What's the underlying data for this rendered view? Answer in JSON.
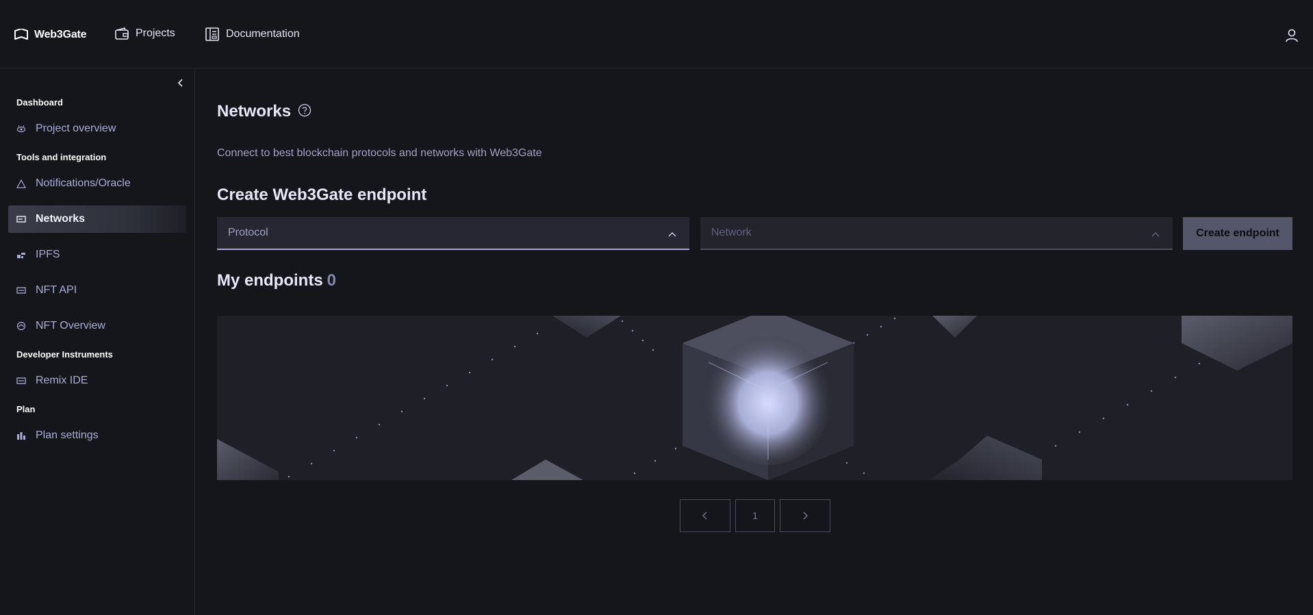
{
  "header": {
    "brand": "Web3Gate",
    "nav": [
      {
        "label": "Projects",
        "icon": "wallet-icon"
      },
      {
        "label": "Documentation",
        "icon": "document-icon"
      }
    ],
    "profile_icon": "user-icon"
  },
  "sidebar": {
    "sections": [
      {
        "title": "Dashboard",
        "items": [
          {
            "label": "Project overview",
            "icon": "eye-icon"
          }
        ]
      },
      {
        "title": "Tools and integration",
        "items": [
          {
            "label": "Notifications/Oracle",
            "icon": "triangle-icon"
          },
          {
            "label": "Networks",
            "icon": "server-icon",
            "active": true
          },
          {
            "label": "IPFS",
            "icon": "blocks-icon"
          },
          {
            "label": "NFT API",
            "icon": "card-icon"
          },
          {
            "label": "NFT Overview",
            "icon": "shield-icon"
          }
        ]
      },
      {
        "title": "Developer Instruments",
        "items": [
          {
            "label": "Remix IDE",
            "icon": "card-icon"
          }
        ]
      },
      {
        "title": "Plan",
        "items": [
          {
            "label": "Plan settings",
            "icon": "bar-chart-icon"
          }
        ]
      }
    ]
  },
  "main": {
    "title": "Networks",
    "subtitle": "Connect to best blockchain protocols and networks with Web3Gate",
    "create_title": "Create Web3Gate endpoint",
    "protocol_placeholder": "Protocol",
    "network_placeholder": "Network",
    "create_button": "Create endpoint",
    "endpoints_title": "My endpoints",
    "endpoints_count": "0",
    "pagination": {
      "current_page": "1"
    }
  },
  "colors": {
    "background": "#15161b",
    "accent": "#a7abd3",
    "button": "#54576a"
  }
}
